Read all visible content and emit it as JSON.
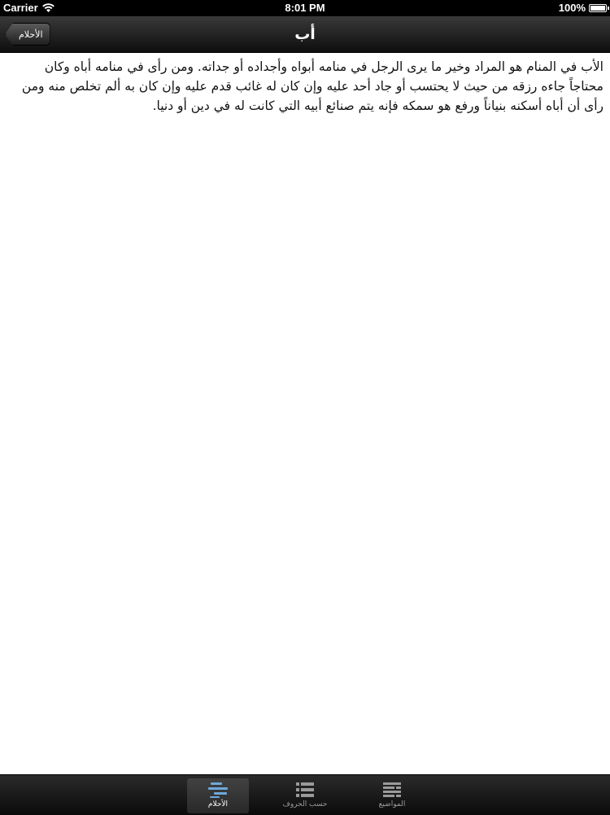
{
  "status_bar": {
    "carrier": "Carrier",
    "time": "8:01 PM",
    "battery": "100%",
    "battery_level": 1.0
  },
  "nav": {
    "back_label": "الأحلام",
    "title": "أب"
  },
  "content": {
    "text": "الأب في المنام هو المراد وخير ما يرى الرجل في منامه أبواه وأجداده أو جداته. ومن رأى في منامه أباه وكان محتاجاً جاءه رزقه من حيث لا يحتسب أو جاد أحد عليه وإن كان له غائب قدم عليه وإن كان به ألم تخلص منه ومن رأى أن أباه أسكنه بنياناً ورفع هو سمكه فإنه يتم صنائع أبيه التي كانت له في دين أو دنيا."
  },
  "tabs": [
    {
      "label": "الأحلام",
      "icon": "dreams-icon",
      "selected": true
    },
    {
      "label": "حسب الحروف",
      "icon": "list-icon",
      "selected": false
    },
    {
      "label": "المواضيع",
      "icon": "topics-icon",
      "selected": false
    }
  ],
  "colors": {
    "tab_active_icon": "#6fa8dc",
    "tab_inactive": "#9a9a9a"
  }
}
